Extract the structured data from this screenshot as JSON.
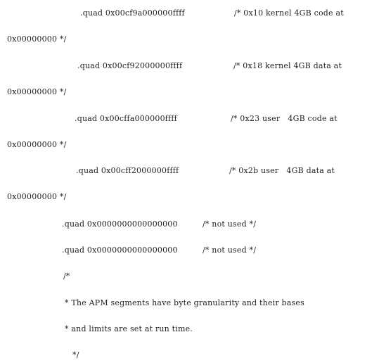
{
  "lines": [
    {
      "code": ".quad 0x00cf9a000000ffff",
      "comment": "/* 0x10 kernel 4GB code at"
    },
    {
      "text": "0x00000000 */"
    },
    {
      "code": ".quad 0x00cf92000000ffff",
      "comment": "/* 0x18 kernel 4GB data at"
    },
    {
      "text": "0x00000000 */"
    },
    {
      "code": ".quad 0x00cffa000000ffff",
      "comment": "/* 0x23 user   4GB code at"
    },
    {
      "text": "0x00000000 */"
    },
    {
      "code": ".quad 0x00cff2000000ffff",
      "comment": "/* 0x2b user   4GB data at"
    },
    {
      "text": "0x00000000 */"
    },
    {
      "code": ".quad 0x0000000000000000",
      "comment": "/* not used */"
    },
    {
      "code": ".quad 0x0000000000000000",
      "comment": "/* not used */"
    },
    {
      "text": "/*"
    },
    {
      "text": "* The APM segments have byte granularity and their bases"
    },
    {
      "text": "* and limits are set at run time."
    },
    {
      "text": "*/"
    }
  ]
}
